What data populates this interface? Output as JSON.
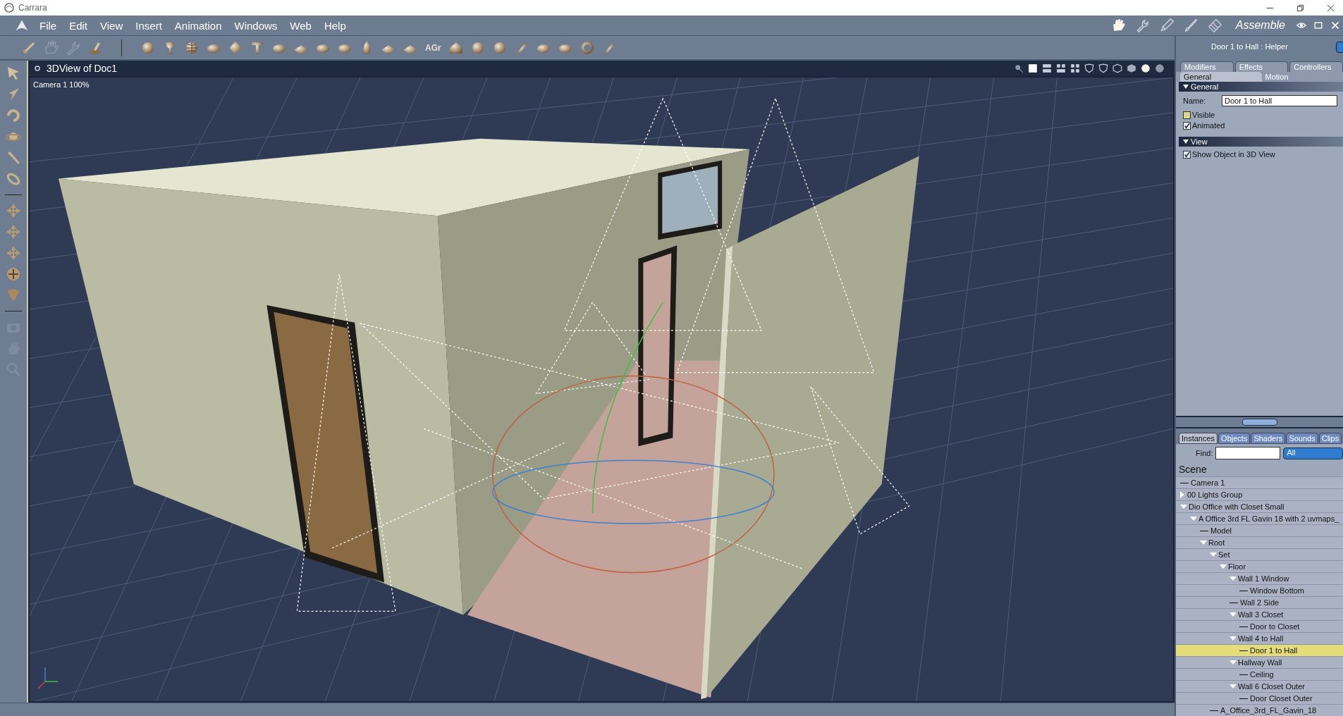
{
  "window": {
    "title": "Carrara"
  },
  "menu": [
    "File",
    "Edit",
    "View",
    "Insert",
    "Animation",
    "Windows",
    "Web",
    "Help"
  ],
  "toolbar": {
    "text_icon_label": "AGr"
  },
  "rooms": {
    "current": "Assemble",
    "items": [
      {
        "kind": "hand",
        "selected": true
      },
      {
        "kind": "wrench",
        "selected": false
      },
      {
        "kind": "pen",
        "selected": false
      },
      {
        "kind": "brush",
        "selected": false
      },
      {
        "kind": "film",
        "selected": false
      }
    ]
  },
  "viewport": {
    "title": "3DView of Doc1",
    "camera_label": "Camera 1 100%"
  },
  "properties": {
    "title": "Door 1 to Hall : Helper",
    "tabs": [
      {
        "label": "Modifiers",
        "selected": false
      },
      {
        "label": "Effects",
        "selected": false
      },
      {
        "label": "Controllers",
        "selected": false
      }
    ],
    "subtabs": [
      {
        "label": "General",
        "selected": true
      },
      {
        "label": "Motion",
        "selected": false
      }
    ],
    "sections": [
      {
        "title": "General",
        "expanded": true,
        "fields": [
          {
            "kind": "text",
            "label": "Name:",
            "value": "Door 1 to Hall"
          },
          {
            "kind": "checkbox",
            "label": "Visible",
            "checked": false
          },
          {
            "kind": "checkbox",
            "label": "Animated",
            "checked": true
          }
        ]
      },
      {
        "title": "View",
        "expanded": true,
        "fields": [
          {
            "kind": "checkbox",
            "label": "Show Object in 3D View",
            "checked": true
          }
        ]
      }
    ]
  },
  "browser": {
    "tabs": [
      {
        "label": "Instances",
        "selected": true
      },
      {
        "label": "Objects",
        "selected": false
      },
      {
        "label": "Shaders",
        "selected": false
      },
      {
        "label": "Sounds",
        "selected": false
      },
      {
        "label": "Clips",
        "selected": false
      }
    ],
    "find_label": "Find:",
    "filter": "All",
    "tree_title": "Scene",
    "tree": [
      {
        "label": "Camera 1",
        "selected": false
      },
      {
        "label": "00 Lights Group",
        "expanded": false,
        "selected": false
      },
      {
        "label": "Dio Office with Closet Small",
        "expanded": true,
        "selected": false,
        "children": [
          {
            "label": "A Office 3rd FL Gavin 18 with 2 uvmaps_",
            "expanded": true,
            "selected": false,
            "children": [
              {
                "label": "Model",
                "selected": false
              },
              {
                "label": "Root",
                "expanded": true,
                "selected": false,
                "children": [
                  {
                    "label": "Set",
                    "expanded": true,
                    "selected": false,
                    "children": [
                      {
                        "label": "Floor",
                        "expanded": true,
                        "selected": false,
                        "children": [
                          {
                            "label": "Wall 1 Window",
                            "expanded": true,
                            "selected": false,
                            "children": [
                              {
                                "label": "Window Bottom",
                                "selected": false
                              }
                            ]
                          },
                          {
                            "label": "Wall 2 Side",
                            "selected": false
                          },
                          {
                            "label": "Wall 3 Closet",
                            "expanded": true,
                            "selected": false,
                            "children": [
                              {
                                "label": "Door to Closet",
                                "selected": false
                              }
                            ]
                          },
                          {
                            "label": "Wall 4 to Hall",
                            "expanded": true,
                            "selected": false,
                            "children": [
                              {
                                "label": "Door 1 to Hall",
                                "selected": true
                              }
                            ]
                          },
                          {
                            "label": "Hallway Wall",
                            "expanded": true,
                            "selected": false,
                            "children": [
                              {
                                "label": "Ceiling",
                                "selected": false
                              }
                            ]
                          },
                          {
                            "label": "Wall 6 Closet Outer",
                            "expanded": true,
                            "selected": false,
                            "children": [
                              {
                                "label": "Door Closet Outer",
                                "selected": false
                              }
                            ]
                          }
                        ]
                      }
                    ]
                  },
                  {
                    "label": "A_Office_3rd_FL_Gavin_18",
                    "selected": false
                  }
                ]
              }
            ]
          }
        ]
      }
    ]
  }
}
